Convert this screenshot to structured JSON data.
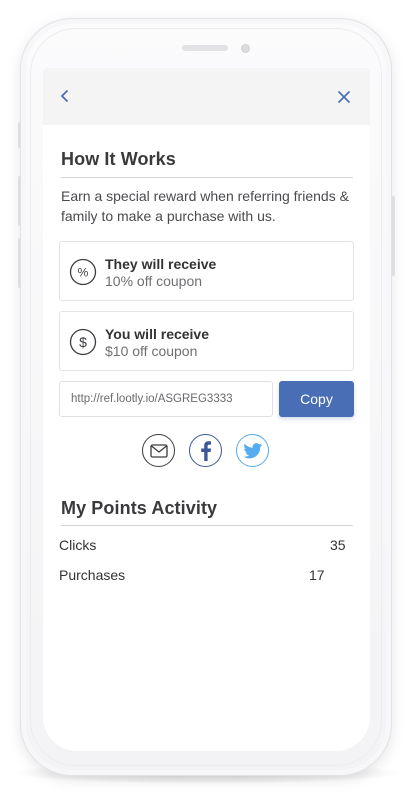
{
  "colors": {
    "accent": "#4a6eb5",
    "facebook": "#3b5998",
    "twitter": "#55acee",
    "topbar_bg": "#f4f4f5"
  },
  "header": {
    "back_icon": "chevron-left-icon",
    "close_icon": "close-icon"
  },
  "how_it_works": {
    "title": "How It Works",
    "description": "Earn a special reward when referring friends & family to make a purchase with us.",
    "rewards": [
      {
        "icon": "percent-icon",
        "title": "They will receive",
        "subtitle": "10% off coupon"
      },
      {
        "icon": "dollar-icon",
        "title": "You will receive",
        "subtitle": "$10 off coupon"
      }
    ]
  },
  "referral": {
    "link_value": "http://ref.lootly.io/ASGREG3333",
    "copy_label": "Copy"
  },
  "share": {
    "icons": [
      "email-icon",
      "facebook-icon",
      "twitter-icon"
    ]
  },
  "points_activity": {
    "title": "My Points Activity",
    "stats": [
      {
        "label": "Clicks",
        "value": "35"
      },
      {
        "label": "Purchases",
        "value": "17"
      }
    ]
  }
}
